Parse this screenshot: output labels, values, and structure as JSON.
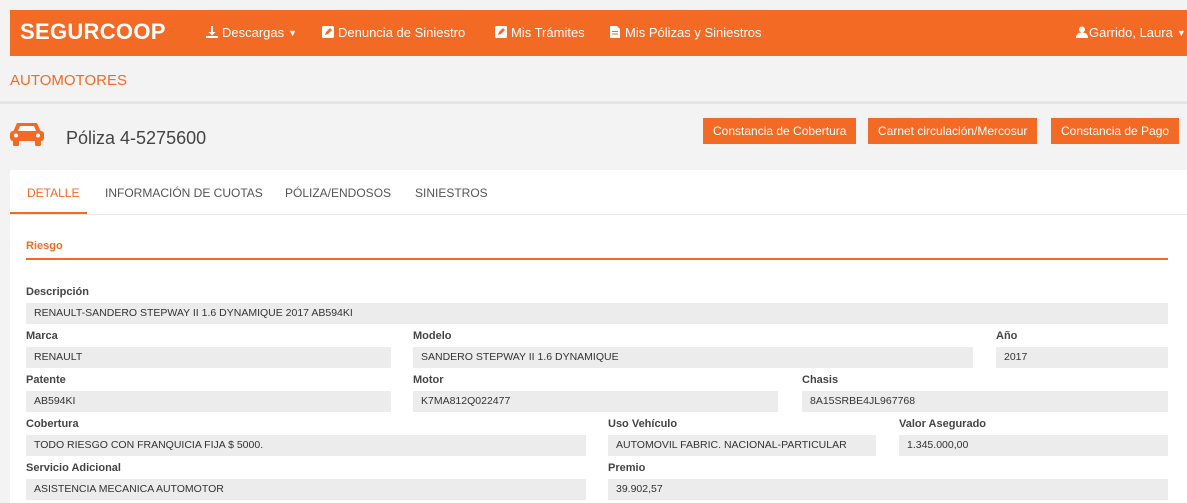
{
  "header": {
    "brand": "SEGURCOOP",
    "nav": [
      {
        "label": "Descargas",
        "icon": "download-icon",
        "dropdown": true
      },
      {
        "label": "Denuncia de Siniestro",
        "icon": "edit-icon"
      },
      {
        "label": "Mis Trámites",
        "icon": "edit-icon"
      },
      {
        "label": "Mis Pólizas y Siniestros",
        "icon": "document-icon"
      }
    ],
    "user": {
      "label": "Garrido, Laura",
      "icon": "user-icon"
    }
  },
  "section_title": "AUTOMOTORES",
  "policy": {
    "icon": "car-icon",
    "title": "Póliza 4-5275600",
    "buttons": [
      "Constancia de Cobertura",
      "Carnet circulación/Mercosur",
      "Constancia de Pago"
    ]
  },
  "tabs": [
    "DETALLE",
    "INFORMACIÓN DE CUOTAS",
    "PÓLIZA/ENDOSOS",
    "SINIESTROS"
  ],
  "active_tab": "DETALLE",
  "risk": {
    "heading": "Riesgo",
    "fields": {
      "descripcion": {
        "label": "Descripción",
        "value": "RENAULT-SANDERO STEPWAY II 1.6 DYNAMIQUE 2017 AB594KI"
      },
      "marca": {
        "label": "Marca",
        "value": "RENAULT"
      },
      "modelo": {
        "label": "Modelo",
        "value": "SANDERO STEPWAY II 1.6 DYNAMIQUE"
      },
      "anio": {
        "label": "Año",
        "value": "2017"
      },
      "patente": {
        "label": "Patente",
        "value": "AB594KI"
      },
      "motor": {
        "label": "Motor",
        "value": "K7MA812Q022477"
      },
      "chasis": {
        "label": "Chasis",
        "value": "8A15SRBE4JL967768"
      },
      "cobertura": {
        "label": "Cobertura",
        "value": "TODO RIESGO CON FRANQUICIA FIJA $ 5000."
      },
      "uso": {
        "label": "Uso Vehículo",
        "value": "AUTOMOVIL FABRIC. NACIONAL-PARTICULAR"
      },
      "valor": {
        "label": "Valor Asegurado",
        "value": "1.345.000,00"
      },
      "servicio": {
        "label": "Servicio Adicional",
        "value": "ASISTENCIA MECANICA AUTOMOTOR"
      },
      "premio": {
        "label": "Premio",
        "value": "39.902,57"
      }
    }
  },
  "colors": {
    "accent": "#f26a23",
    "field_bg": "#ececec",
    "page_bg": "#f3f3f3"
  }
}
